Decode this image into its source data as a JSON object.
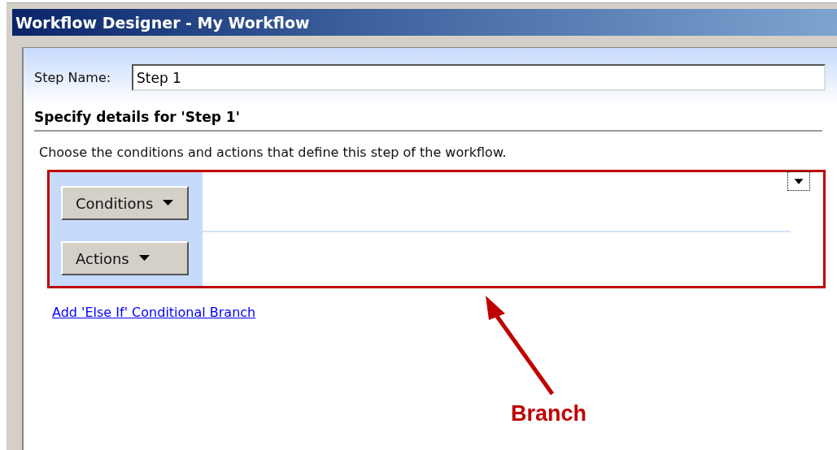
{
  "window": {
    "title": "Workflow Designer - My Workflow"
  },
  "step_name": {
    "label": "Step Name:",
    "value": "Step 1"
  },
  "section": {
    "heading": "Specify details for 'Step 1'",
    "description": "Choose the conditions and actions that define this step of the workflow."
  },
  "branch": {
    "highlighted": true,
    "buttons": [
      {
        "label": "Conditions"
      },
      {
        "label": "Actions"
      }
    ]
  },
  "links": [
    {
      "label": "Add 'Else If' Conditional Branch"
    }
  ],
  "annotation": {
    "label": "Branch"
  }
}
